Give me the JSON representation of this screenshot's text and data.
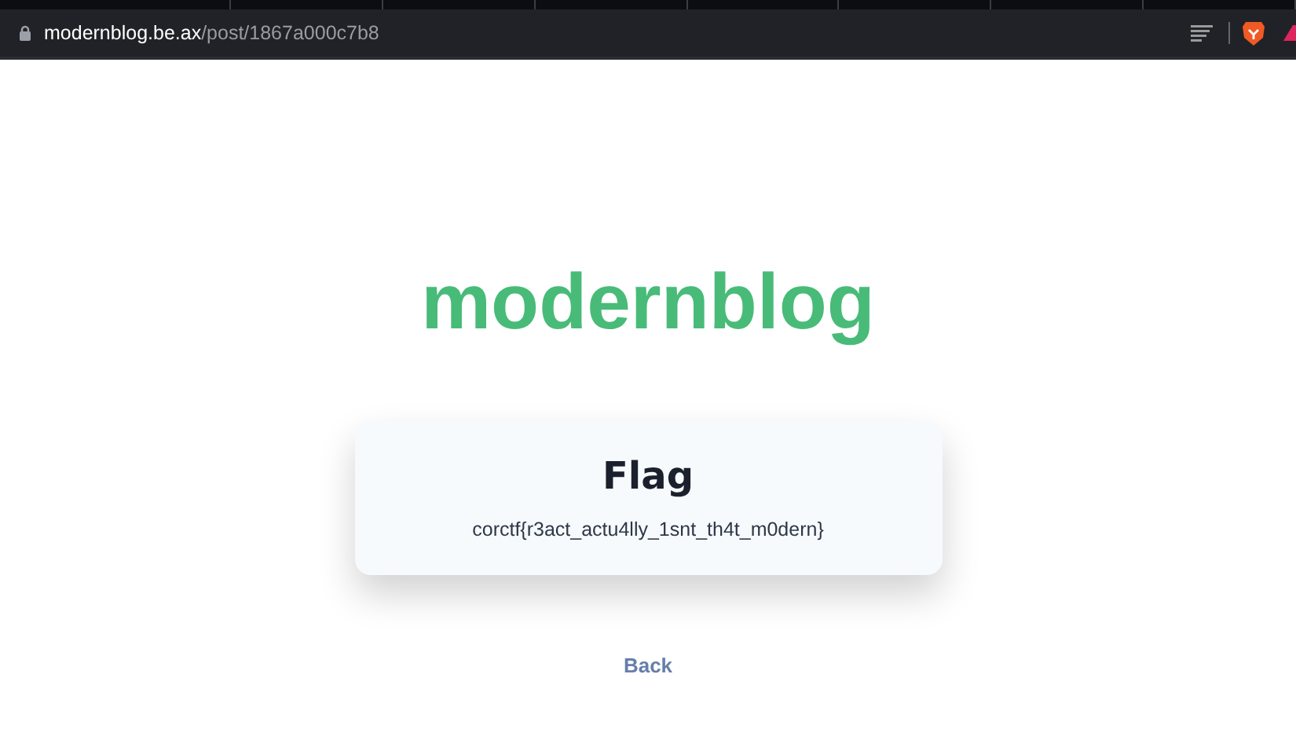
{
  "browser": {
    "url_host": "modernblog.be.ax",
    "url_path": "/post/1867a000c7b8"
  },
  "page": {
    "site_title": "modernblog",
    "card": {
      "title": "Flag",
      "body": "corctf{r3act_actu4lly_1snt_th4t_m0dern}"
    },
    "back_link": "Back"
  }
}
